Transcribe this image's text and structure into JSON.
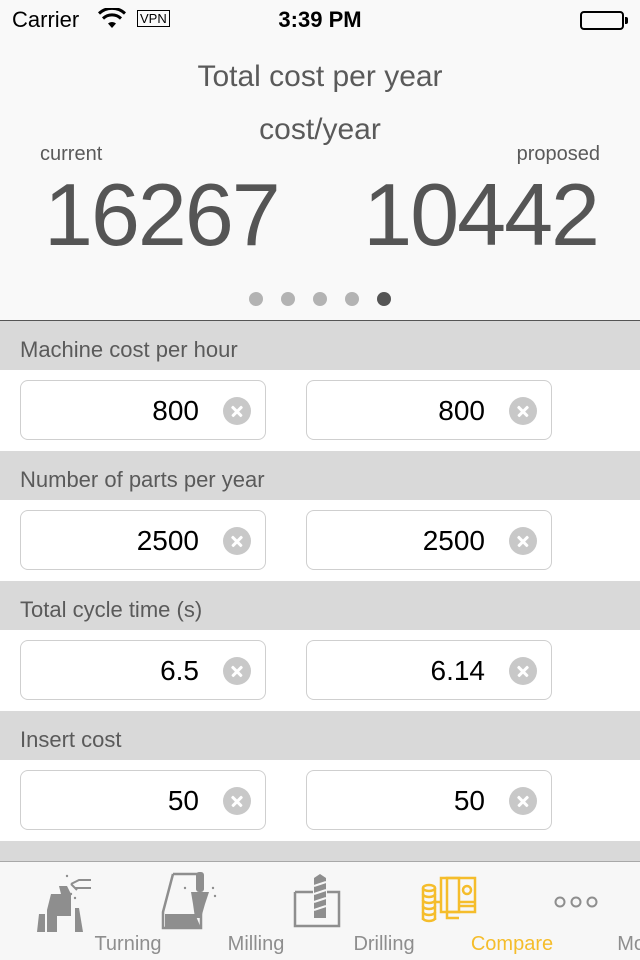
{
  "status_bar": {
    "carrier": "Carrier",
    "vpn": "VPN",
    "time": "3:39 PM"
  },
  "summary": {
    "title": "Total cost per year",
    "subtitle": "cost/year",
    "current_label": "current",
    "proposed_label": "proposed",
    "current_value": "16267",
    "proposed_value": "10442",
    "page_count": 5,
    "active_page": 5
  },
  "sections": [
    {
      "label": "Machine cost per hour",
      "current": "800",
      "proposed": "800"
    },
    {
      "label": "Number of parts per year",
      "current": "2500",
      "proposed": "2500"
    },
    {
      "label": "Total cycle time (s)",
      "current": "6.5",
      "proposed": "6.14"
    },
    {
      "label": "Insert cost",
      "current": "50",
      "proposed": "50"
    }
  ],
  "tabs": [
    {
      "label": "Turning",
      "icon": "turning-icon",
      "active": false
    },
    {
      "label": "Milling",
      "icon": "milling-icon",
      "active": false
    },
    {
      "label": "Drilling",
      "icon": "drilling-icon",
      "active": false
    },
    {
      "label": "Compare",
      "icon": "compare-icon",
      "active": true
    },
    {
      "label": "More",
      "icon": "more-icon",
      "active": false
    }
  ],
  "colors": {
    "accent": "#f5bd2b",
    "inactive_tab": "#8e8e8e",
    "section_header_bg": "#d9d9d9"
  }
}
